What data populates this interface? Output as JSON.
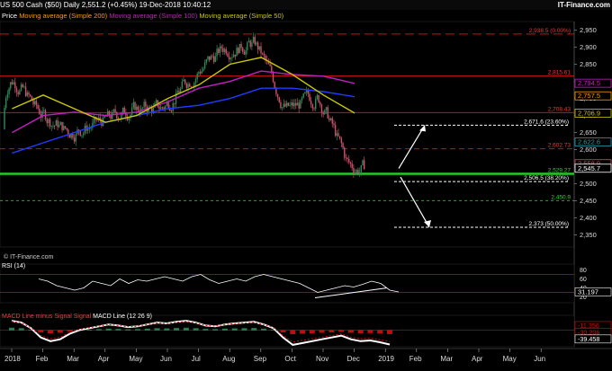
{
  "header": {
    "symbol": "US 500 Cash ($50)",
    "period": "Daily",
    "price_change": "2,551.2 (+0.45%)",
    "datetime": "19-Dec-2018 10:40:12",
    "brand": "IT-Finance.com"
  },
  "colors": {
    "ma200": "#1f3cff",
    "ma100": "#c020c0",
    "ma50": "#c8c800",
    "up": "#2e8b57",
    "down": "#d0506a",
    "resistance": "#d01010",
    "support": "#22cc22",
    "fib": "#ffffff"
  },
  "legend": {
    "price": "Price",
    "ma200": "Moving average (Simple 200)",
    "ma100": "Moving average (Simple 100)",
    "ma50": "Moving average (Simple 50)"
  },
  "watermark": "© IT-Finance.com",
  "chart_data": [
    {
      "type": "candlestick",
      "x": [
        "2018-01",
        "2018-02",
        "2018-03",
        "2018-04",
        "2018-05",
        "2018-06",
        "2018-07",
        "2018-08",
        "2018-09",
        "2018-10",
        "2018-11",
        "2018-12"
      ],
      "close": [
        2840,
        2710,
        2650,
        2680,
        2720,
        2720,
        2820,
        2900,
        2910,
        2710,
        2760,
        2545
      ],
      "ylim": [
        2315,
        2975
      ],
      "y_ticks": [
        "2,950",
        "2,900",
        "2,850",
        "2,800",
        "2,750",
        "2,700",
        "2,650",
        "2,600",
        "2,550",
        "2,500",
        "2,450",
        "2,400",
        "2,350"
      ],
      "x_ticks": [
        "2018",
        "Feb",
        "Mar",
        "Apr",
        "May",
        "Jun",
        "Jul",
        "Aug",
        "Sep",
        "Oct",
        "Nov",
        "Dec",
        "2019",
        "Feb",
        "Mar",
        "Apr",
        "May",
        "Jun"
      ],
      "horizontal_levels": [
        {
          "label": "2,938.5 (0.00%)",
          "value": 2938.5,
          "style": "dashed-red"
        },
        {
          "label": "2,815.61",
          "value": 2815.61,
          "style": "solid-red"
        },
        {
          "label": "2,708.43",
          "value": 2708.43,
          "style": "solid-red"
        },
        {
          "label": "2,671.6 (23.60%)",
          "value": 2671.6,
          "style": "dashed-white"
        },
        {
          "label": "2,602.73",
          "value": 2602.73,
          "style": "dashed-red"
        },
        {
          "label": "2,529.27",
          "value": 2529.27,
          "style": "solid-green"
        },
        {
          "label": "2,506.5 (38.20%)",
          "value": 2506.5,
          "style": "dashed-white"
        },
        {
          "label": "2,450.9",
          "value": 2450.9,
          "style": "dashed-green"
        },
        {
          "label": "2,373 (50.00%)",
          "value": 2373,
          "style": "dashed-white"
        }
      ],
      "current_value_tags": [
        {
          "label": "2,794.5",
          "value": 2794.5,
          "color": "#c020c0"
        },
        {
          "label": "2,757.5",
          "value": 2757.5,
          "color": "#ff9a00"
        },
        {
          "label": "2,706.9",
          "value": 2706.9,
          "color": "#c8c800"
        },
        {
          "label": "2,622.6",
          "value": 2622.6,
          "color": "#1f9fb0"
        },
        {
          "label": "2,558.9",
          "value": 2558.9,
          "color": "#d0506a"
        },
        {
          "label": "2,545.7",
          "value": 2545.7,
          "color": "#ffffff"
        }
      ],
      "series": [
        {
          "name": "Moving average (Simple 200)",
          "values": [
            2590,
            2620,
            2650,
            2680,
            2700,
            2720,
            2730,
            2750,
            2780,
            2780,
            2770,
            2755
          ]
        },
        {
          "name": "Moving average (Simple 100)",
          "values": [
            2650,
            2700,
            2710,
            2700,
            2710,
            2740,
            2780,
            2800,
            2830,
            2820,
            2815,
            2794
          ]
        },
        {
          "name": "Moving average (Simple 50)",
          "values": [
            2720,
            2760,
            2720,
            2680,
            2700,
            2750,
            2790,
            2850,
            2870,
            2820,
            2760,
            2707
          ]
        }
      ],
      "annotations": [
        "arrow-up to 2,671.6",
        "arrow-down to 2,373"
      ]
    },
    {
      "type": "line",
      "title": "RSI (14)",
      "current": "31.197",
      "ylim": [
        15,
        85
      ],
      "y_ticks": [
        "80",
        "60",
        "40",
        "20"
      ],
      "levels": [
        70,
        30
      ],
      "values": [
        60,
        55,
        45,
        40,
        35,
        40,
        55,
        50,
        45,
        60,
        50,
        58,
        55,
        60,
        65,
        60,
        55,
        65,
        70,
        58,
        50,
        55,
        60,
        55,
        65,
        70,
        65,
        60,
        55,
        50,
        40,
        30,
        35,
        40,
        45,
        42,
        48,
        55,
        50,
        35,
        31
      ]
    },
    {
      "type": "line",
      "title": "MACD Line minus Signal Signal",
      "title2": "MACD Line (12 26 9)",
      "current_tags": [
        "-11.356",
        "-30.206",
        "-39.458"
      ],
      "values": [
        25,
        20,
        5,
        -20,
        -30,
        -25,
        -10,
        0,
        5,
        10,
        15,
        12,
        8,
        10,
        15,
        20,
        18,
        22,
        25,
        20,
        12,
        10,
        15,
        18,
        20,
        22,
        15,
        5,
        -20,
        -40,
        -35,
        -30,
        -25,
        -20,
        -15,
        -25,
        -30,
        -28,
        -33,
        -39
      ]
    }
  ]
}
